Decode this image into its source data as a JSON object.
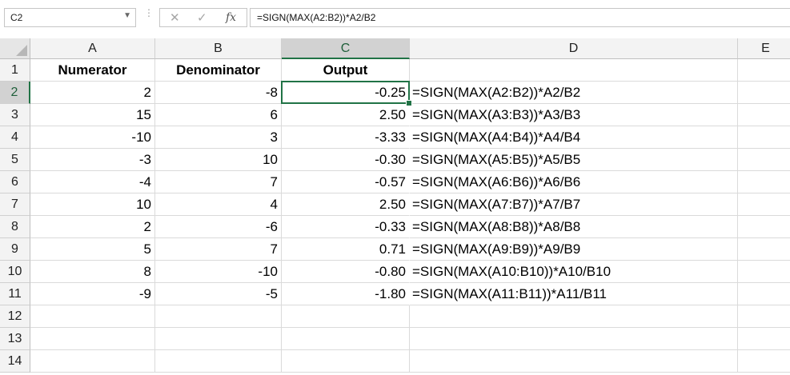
{
  "name_box": "C2",
  "formula_bar": {
    "cancel_icon": "✕",
    "enter_icon": "✓",
    "fx_label": "fx",
    "formula": "=SIGN(MAX(A2:B2))*A2/B2"
  },
  "columns": [
    "A",
    "B",
    "C",
    "D",
    "E"
  ],
  "active_column": "C",
  "active_row": 2,
  "rows": [
    {
      "n": "1",
      "A": "Numerator",
      "B": "Denominator",
      "C": "Output",
      "D": ""
    },
    {
      "n": "2",
      "A": "2",
      "B": "-8",
      "C": "-0.25",
      "D": "=SIGN(MAX(A2:B2))*A2/B2"
    },
    {
      "n": "3",
      "A": "15",
      "B": "6",
      "C": "2.50",
      "D": "=SIGN(MAX(A3:B3))*A3/B3"
    },
    {
      "n": "4",
      "A": "-10",
      "B": "3",
      "C": "-3.33",
      "D": "=SIGN(MAX(A4:B4))*A4/B4"
    },
    {
      "n": "5",
      "A": "-3",
      "B": "10",
      "C": "-0.30",
      "D": "=SIGN(MAX(A5:B5))*A5/B5"
    },
    {
      "n": "6",
      "A": "-4",
      "B": "7",
      "C": "-0.57",
      "D": "=SIGN(MAX(A6:B6))*A6/B6"
    },
    {
      "n": "7",
      "A": "10",
      "B": "4",
      "C": "2.50",
      "D": "=SIGN(MAX(A7:B7))*A7/B7"
    },
    {
      "n": "8",
      "A": "2",
      "B": "-6",
      "C": "-0.33",
      "D": "=SIGN(MAX(A8:B8))*A8/B8"
    },
    {
      "n": "9",
      "A": "5",
      "B": "7",
      "C": "0.71",
      "D": "=SIGN(MAX(A9:B9))*A9/B9"
    },
    {
      "n": "10",
      "A": "8",
      "B": "-10",
      "C": "-0.80",
      "D": "=SIGN(MAX(A10:B10))*A10/B10"
    },
    {
      "n": "11",
      "A": "-9",
      "B": "-5",
      "C": "-1.80",
      "D": "=SIGN(MAX(A11:B11))*A11/B11"
    },
    {
      "n": "12",
      "A": "",
      "B": "",
      "C": "",
      "D": ""
    },
    {
      "n": "13",
      "A": "",
      "B": "",
      "C": "",
      "D": ""
    },
    {
      "n": "14",
      "A": "",
      "B": "",
      "C": "",
      "D": ""
    }
  ],
  "colors": {
    "accent": "#217346"
  }
}
